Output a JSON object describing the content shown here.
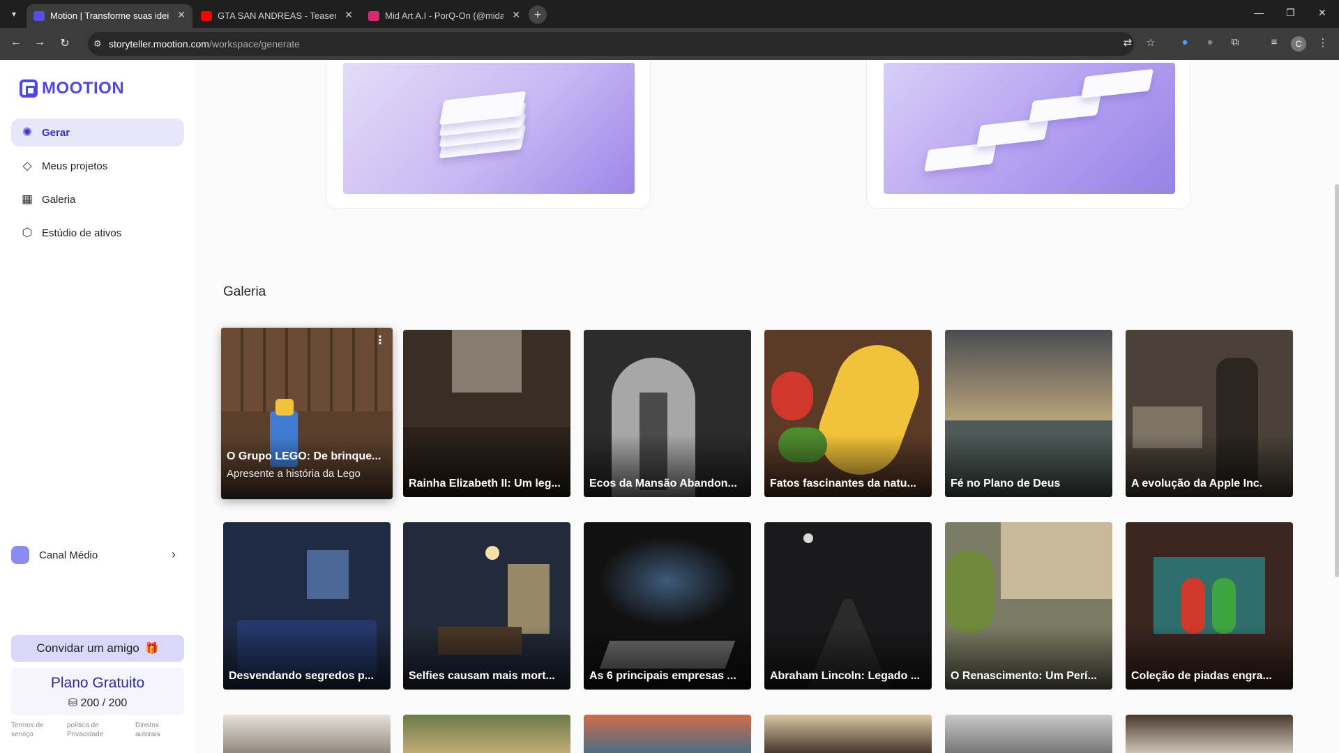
{
  "browser": {
    "tabs": [
      {
        "label": "Motion | Transforme suas ideias",
        "active": true,
        "favicon_color": "#5b4de0"
      },
      {
        "label": "GTA SAN ANDREAS - Teaser Tra",
        "active": false,
        "favicon_color": "#ff0000"
      },
      {
        "label": "Mid Art A.I - PorQ-On (@midar",
        "active": false,
        "favicon_color": "#d62976"
      }
    ],
    "new_tab_symbol": "+",
    "url_host": "storyteller.mootion.com",
    "url_path": "/workspace/generate",
    "profile_initial": "C"
  },
  "sidebar": {
    "brand": "MOOTION",
    "nav": [
      {
        "label": "Gerar",
        "icon": "palette-icon",
        "active": true
      },
      {
        "label": "Meus projetos",
        "icon": "diamond-icon",
        "active": false
      },
      {
        "label": "Galeria",
        "icon": "grid-icon",
        "active": false
      },
      {
        "label": "Estúdio de ativos",
        "icon": "box-icon",
        "active": false
      }
    ],
    "channel": "Canal Médio",
    "invite_label": "Convidar um amigo",
    "plan_name": "Plano Gratuito",
    "credits": "200 / 200",
    "legal": [
      {
        "line1": "Termos de",
        "line2": "serviço"
      },
      {
        "line1": "política de",
        "line2": "Privacidade"
      },
      {
        "line1": "Direitos",
        "line2": "autorais"
      }
    ]
  },
  "main": {
    "gallery_title": "Galeria",
    "rows": [
      [
        {
          "title": "O Grupo LEGO: De brinque...",
          "subtitle": "Apresente a história da Lego",
          "hover": true,
          "bg": "#5a3f2c"
        },
        {
          "title": "Rainha Elizabeth II: Um leg...",
          "bg": "#3a2e24"
        },
        {
          "title": "Ecos da Mansão Abandon...",
          "bg": "#2c2c2c"
        },
        {
          "title": "Fatos fascinantes da natu...",
          "bg": "#5b3a26"
        },
        {
          "title": "Fé no Plano de Deus",
          "bg": "#6d6a5e"
        },
        {
          "title": "A evolução da Apple Inc.",
          "bg": "#4a4238"
        }
      ],
      [
        {
          "title": "Desvendando segredos p...",
          "bg": "#1f2a44"
        },
        {
          "title": "Selfies causam mais mort...",
          "bg": "#232a3a"
        },
        {
          "title": "As 6 principais empresas ...",
          "bg": "#111111"
        },
        {
          "title": "Abraham Lincoln: Legado ...",
          "bg": "#1a1a1c"
        },
        {
          "title": "O Renascimento: Um Perí...",
          "bg": "#7b7a63"
        },
        {
          "title": "Coleção de piadas engra...",
          "bg": "#3b2620"
        }
      ]
    ]
  }
}
